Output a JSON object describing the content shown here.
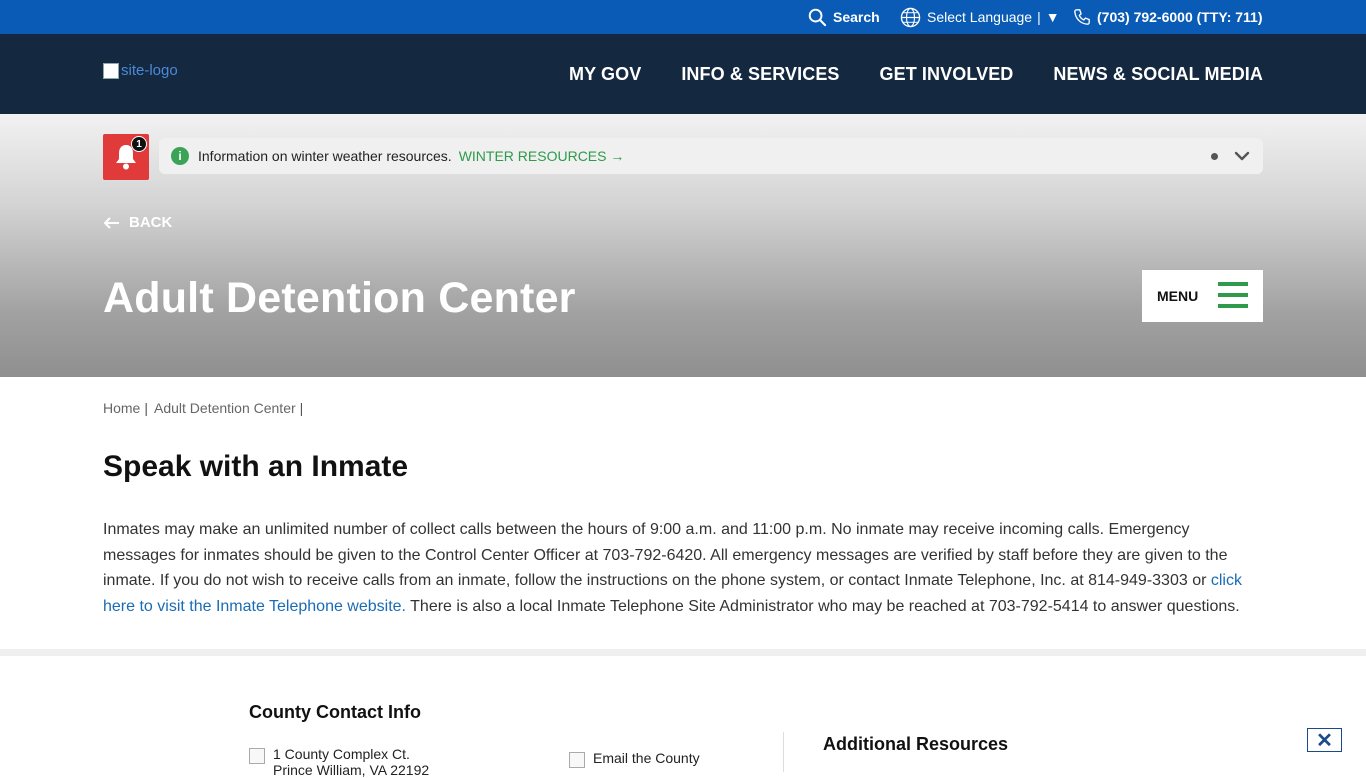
{
  "utility_bar": {
    "search_label": "Search",
    "language_label": "Select Language",
    "language_separator": "|",
    "language_arrow": "▼",
    "phone_label": "(703) 792-6000 (TTY: 711)"
  },
  "header": {
    "logo_alt": "site-logo",
    "nav": [
      {
        "label": "MY GOV"
      },
      {
        "label": "INFO & SERVICES"
      },
      {
        "label": "GET INVOLVED"
      },
      {
        "label": "NEWS & SOCIAL MEDIA"
      }
    ]
  },
  "alert": {
    "badge_count": "1",
    "info_icon": "i",
    "message": "Information on winter weather resources.",
    "link_label": "WINTER RESOURCES",
    "link_arrow": "→"
  },
  "hero": {
    "back_label": "BACK",
    "title": "Adult Detention Center",
    "menu_label": "MENU"
  },
  "breadcrumb": {
    "items": [
      {
        "label": "Home"
      },
      {
        "label": "Adult Detention Center"
      }
    ],
    "separator": "|"
  },
  "main": {
    "section_title": "Speak with an Inmate",
    "body_before_link": "Inmates may make an unlimited number of collect calls between the hours of 9:00 a.m. and 11:00 p.m. No inmate may receive incoming calls. Emergency messages for inmates should be given to the Control Center Officer at 703-792-6420. All emergency messages are verified by staff before they are given to the inmate. If you do not wish to receive calls from an inmate, follow the instructions on the phone system, or contact Inmate Telephone, Inc. at 814-949-3303 or ",
    "body_link": "click here to visit the Inmate Telephone website.",
    "body_after_link": " There is also a local Inmate Telephone Site Administrator who may be reached at 703-792-5414 to answer questions."
  },
  "footer": {
    "contact_title": "County Contact Info",
    "address_line1": "1 County Complex Ct.",
    "address_line2": "Prince William, VA 22192",
    "email_label": "Email the County",
    "resources_title": "Additional Resources",
    "close_label": "✕"
  },
  "colors": {
    "utility_bar": "#0a5bb5",
    "nav_bg": "#142840",
    "accent_green": "#2e9a4a",
    "alert_red": "#e03a3a",
    "link_blue": "#1a6bb5"
  }
}
